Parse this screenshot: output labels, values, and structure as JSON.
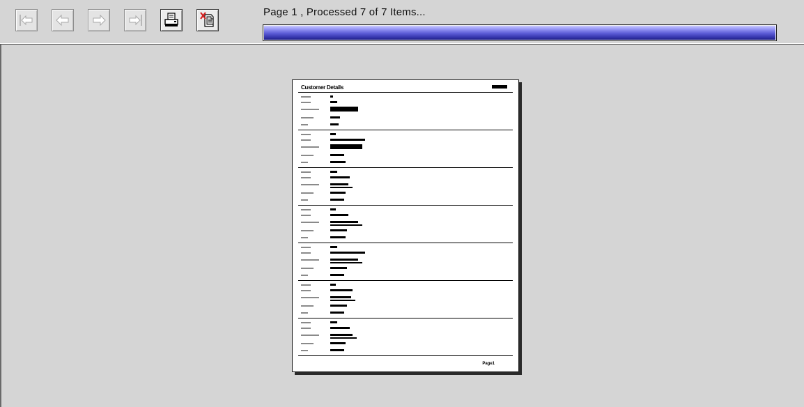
{
  "toolbar": {
    "buttons": [
      {
        "icon": "first-page-icon",
        "enabled": false
      },
      {
        "icon": "previous-page-icon",
        "enabled": false
      },
      {
        "icon": "next-page-icon",
        "enabled": false
      },
      {
        "icon": "last-page-icon",
        "enabled": false
      },
      {
        "icon": "print-icon",
        "enabled": true
      },
      {
        "icon": "cancel-print-icon",
        "enabled": true
      }
    ],
    "status": "Page 1 , Processed 7 of 7 Items...",
    "progress": 1.0
  },
  "colors": {
    "background": "#d5d5d5",
    "progress_fill": "#3232a8",
    "cancel_x": "#d42020"
  },
  "preview": {
    "title": "Customer Details",
    "footer": "Page1",
    "record_count": 7
  }
}
